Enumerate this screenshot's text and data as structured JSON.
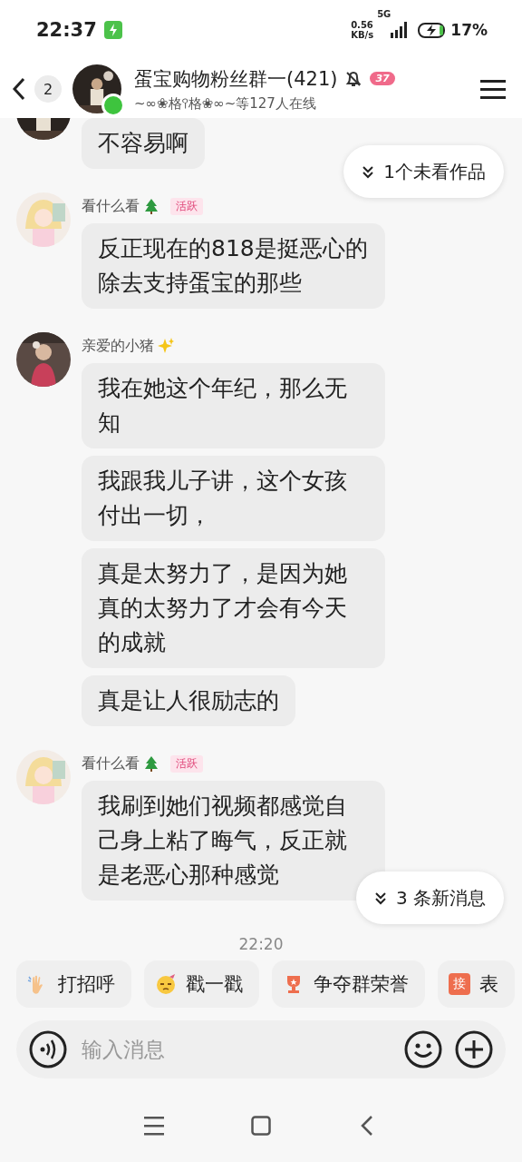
{
  "status_bar": {
    "time": "22:37",
    "network_speed": "0.56",
    "speed_unit": "KB/s",
    "network_type": "5G",
    "battery": "17%"
  },
  "header": {
    "unread_count": "2",
    "title": "蛋宝购物粉丝群一(421)",
    "level_badge": "37",
    "online": "~∞❀格⫯格❀∞~等127人在线"
  },
  "unseen_pill": "1个未看作品",
  "messages": [
    {
      "bubbles": [
        "不容易啊"
      ]
    },
    {
      "sender": "看什么看",
      "badge": "活跃",
      "bubbles": [
        "反正现在的818是挺恶心的除去支持蛋宝的那些"
      ]
    },
    {
      "sender": "亲爱的小猪",
      "bubbles": [
        "我在她这个年纪，那么无知",
        "我跟我儿子讲，这个女孩付出一切，",
        "真是太努力了，是因为她真的太努力了才会有今天的成就",
        "真是让人很励志的"
      ]
    },
    {
      "sender": "看什么看",
      "badge": "活跃",
      "bubbles": [
        "我刷到她们视频都感觉自己身上粘了晦气，反正就是老恶心那种感觉"
      ]
    }
  ],
  "new_messages_pill": "3 条新消息",
  "timestamp": "22:20",
  "quick_actions": [
    {
      "label": "打招呼"
    },
    {
      "label": "戳一戳"
    },
    {
      "label": "争夺群荣誉"
    },
    {
      "icon_text": "接",
      "label": "表"
    }
  ],
  "input": {
    "placeholder": "输入消息"
  }
}
